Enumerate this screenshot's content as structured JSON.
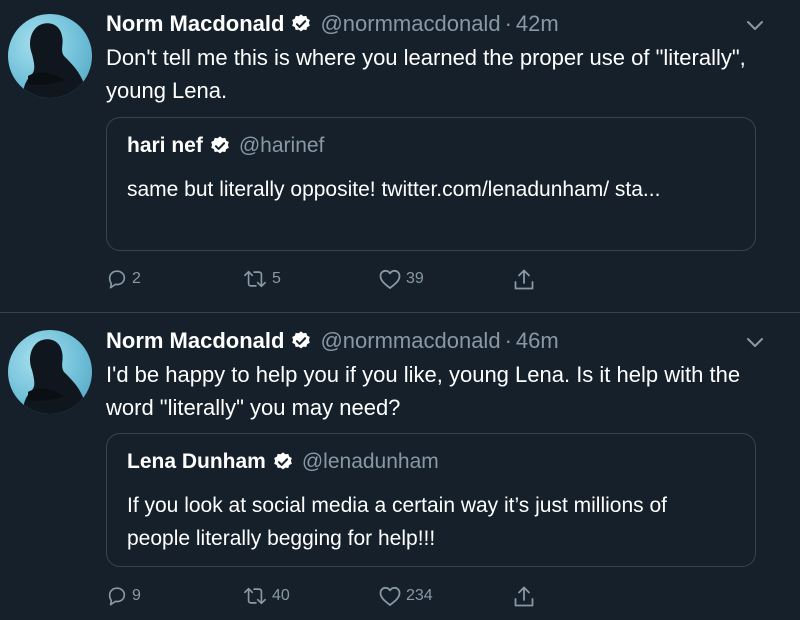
{
  "tweets": [
    {
      "author_name": "Norm Macdonald",
      "author_handle": "@normmacdonald",
      "separator": "·",
      "time": "42m",
      "text": "Don't tell me this is where you learned the proper use of \"literally\", young Lena.",
      "quote": {
        "author_name": "hari nef",
        "author_handle": "@harinef",
        "text": "same but literally opposite! twitter.com/lenadunham/ sta..."
      },
      "replies": "2",
      "retweets": "5",
      "likes": "39"
    },
    {
      "author_name": "Norm Macdonald",
      "author_handle": "@normmacdonald",
      "separator": "·",
      "time": "46m",
      "text": "I'd be happy to help you if you like, young Lena. Is it help with the word \"literally\" you may need?",
      "quote": {
        "author_name": "Lena Dunham",
        "author_handle": "@lenadunham",
        "text": "If you look at social media a certain way it’s just millions of people literally begging for help!!!"
      },
      "replies": "9",
      "retweets": "40",
      "likes": "234"
    }
  ],
  "icons": {
    "reply": "reply-icon",
    "retweet": "retweet-icon",
    "like": "heart-icon",
    "share": "share-icon",
    "verified": "verified-badge-icon",
    "caret": "chevron-down-icon"
  },
  "colors": {
    "background": "#15202b",
    "border": "#38444d",
    "secondary_text": "#8899a6",
    "primary_text": "#ffffff",
    "verified_badge": "#ffffff"
  }
}
